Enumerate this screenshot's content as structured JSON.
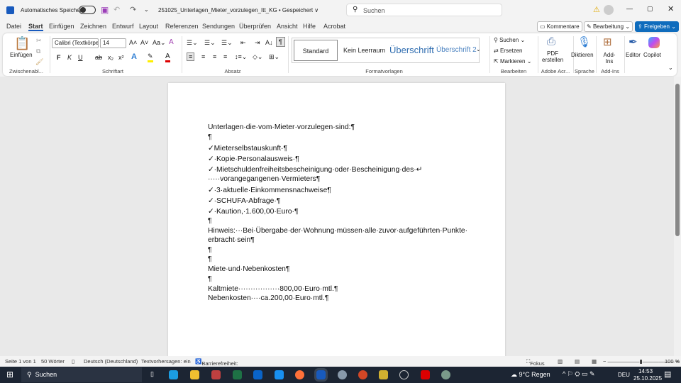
{
  "titlebar": {
    "autosave_label": "Automatisches Speichern",
    "doc_title": "251025_Unterlagen_Mieter_vorzulegen_Itt_KG • Gespeichert ∨",
    "search_placeholder": "Suchen"
  },
  "tabs": [
    "Datei",
    "Start",
    "Einfügen",
    "Zeichnen",
    "Entwurf",
    "Layout",
    "Referenzen",
    "Sendungen",
    "Überprüfen",
    "Ansicht",
    "Hilfe",
    "Acrobat"
  ],
  "tab_buttons": {
    "comments": "Kommentare",
    "editing": "Bearbeitung",
    "share": "Freigeben"
  },
  "ribbon": {
    "clipboard": {
      "paste": "Einfügen",
      "group": "Zwischenabl..."
    },
    "font": {
      "name": "Calibri (Textkörpe",
      "size": "14",
      "group": "Schriftart"
    },
    "paragraph": {
      "group": "Absatz"
    },
    "styles": {
      "items": [
        "Standard",
        "Kein Leerraum",
        "Überschrift",
        "Überschrift 2"
      ],
      "group": "Formatvorlagen"
    },
    "editing": {
      "find": "Suchen",
      "replace": "Ersetzen",
      "select": "Markieren",
      "group": "Bearbeiten"
    },
    "adobe": {
      "pdf": "PDF erstellen",
      "group": "Adobe Acr..."
    },
    "voice": {
      "dictate": "Diktieren",
      "group": "Sprache"
    },
    "addins": {
      "label": "Add-Ins",
      "group": "Add-Ins"
    },
    "editor": "Editor",
    "copilot": "Copilot"
  },
  "document": {
    "lines": [
      "Unterlagen·die·vom·Mieter·vorzulegen·sind:¶",
      "¶",
      "✓Mieterselbstauskunft·¶",
      "✓·Kopie·Personalausweis·¶",
      "✓·Mietschuldenfreiheitsbescheinigung·oder·Bescheinigung·des·↵",
      "·····vorangegangenen·Vermieters¶",
      "✓·3·aktuelle·Einkommensnachweise¶",
      "✓·SCHUFA-Abfrage·¶",
      "✓·Kaution,·1.600,00·Euro·¶",
      "¶",
      "Hinweis:···Bei·Übergabe·der·Wohnung·müssen·alle·zuvor·aufgeführten·Punkte·",
      "erbracht·sein¶",
      "¶",
      "¶",
      "Miete·und·Nebenkosten¶",
      "¶",
      "Kaltmiete·················800,00·Euro·mtl.¶",
      "Nebenkosten····ca.200,00·Euro·mtl.¶"
    ]
  },
  "status": {
    "page": "Seite 1 von 1",
    "words": "50 Wörter",
    "language": "Deutsch (Deutschland)",
    "predictions": "Textvorhersagen: ein",
    "accessibility": "Barrierefreiheit: Keine Probleme",
    "focus": "Fokus",
    "zoom": "100 %"
  },
  "taskbar": {
    "search": "Suchen",
    "weather": "9°C  Regen",
    "lang": "DEU",
    "time": "14:53",
    "date": "25.10.2025"
  },
  "colors": {
    "accent": "#185abd",
    "share": "#0f6cbd"
  }
}
